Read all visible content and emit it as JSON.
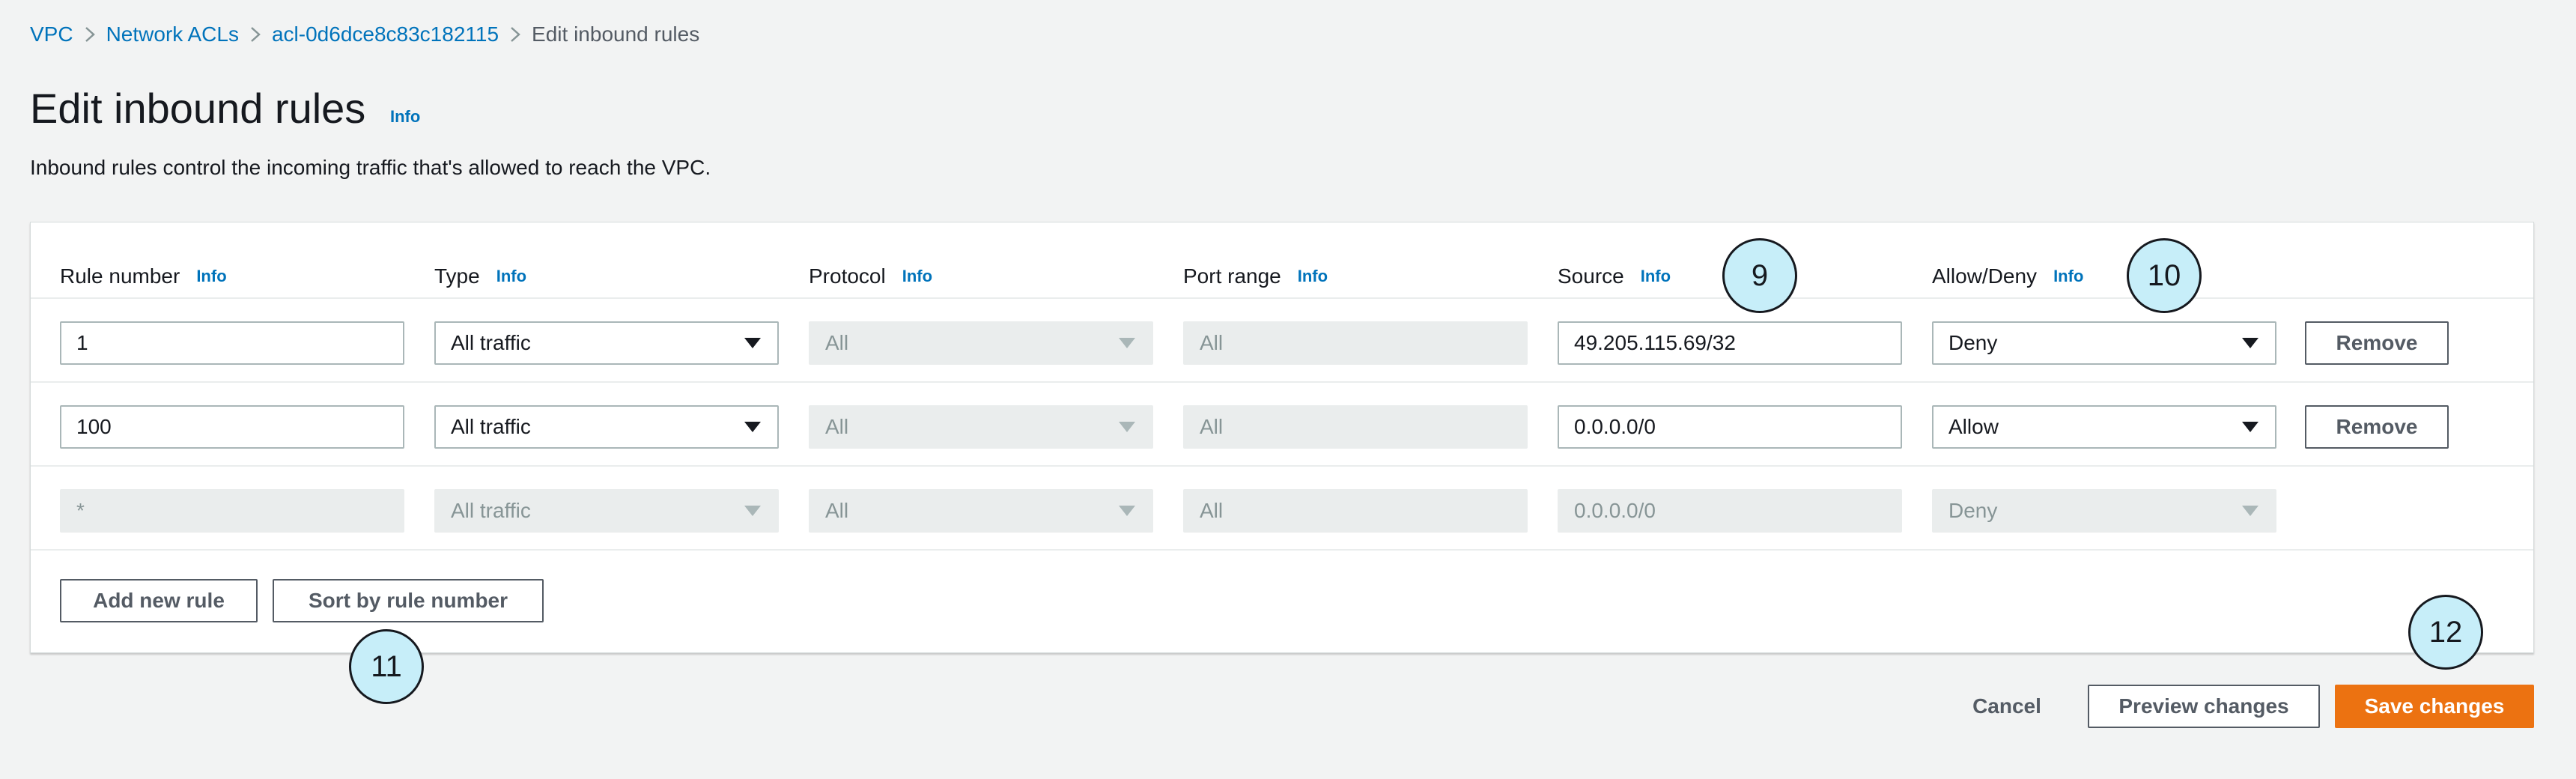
{
  "breadcrumb": {
    "items": [
      "VPC",
      "Network ACLs",
      "acl-0d6dce8c83c182115"
    ],
    "current": "Edit inbound rules"
  },
  "header": {
    "title": "Edit inbound rules",
    "info": "Info",
    "description": "Inbound rules control the incoming traffic that's allowed to reach the VPC."
  },
  "table": {
    "columns": [
      {
        "label": "Rule number",
        "info": "Info"
      },
      {
        "label": "Type",
        "info": "Info"
      },
      {
        "label": "Protocol",
        "info": "Info"
      },
      {
        "label": "Port range",
        "info": "Info"
      },
      {
        "label": "Source",
        "info": "Info"
      },
      {
        "label": "Allow/Deny",
        "info": "Info"
      }
    ],
    "rows": [
      {
        "rule_number": "1",
        "type": "All traffic",
        "protocol": "All",
        "port_range": "All",
        "source": "49.205.115.69/32",
        "action": "Deny",
        "remove": "Remove"
      },
      {
        "rule_number": "100",
        "type": "All traffic",
        "protocol": "All",
        "port_range": "All",
        "source": "0.0.0.0/0",
        "action": "Allow",
        "remove": "Remove"
      },
      {
        "rule_number": "*",
        "type": "All traffic",
        "protocol": "All",
        "port_range": "All",
        "source": "0.0.0.0/0",
        "action": "Deny"
      }
    ],
    "add_rule": "Add new rule",
    "sort_rule": "Sort by rule number"
  },
  "footer": {
    "cancel": "Cancel",
    "preview": "Preview changes",
    "save": "Save changes"
  },
  "annotations": [
    "9",
    "10",
    "11",
    "12"
  ],
  "colors": {
    "link": "#0073bb",
    "primary": "#ec7211",
    "badge": "#c7eef9"
  }
}
